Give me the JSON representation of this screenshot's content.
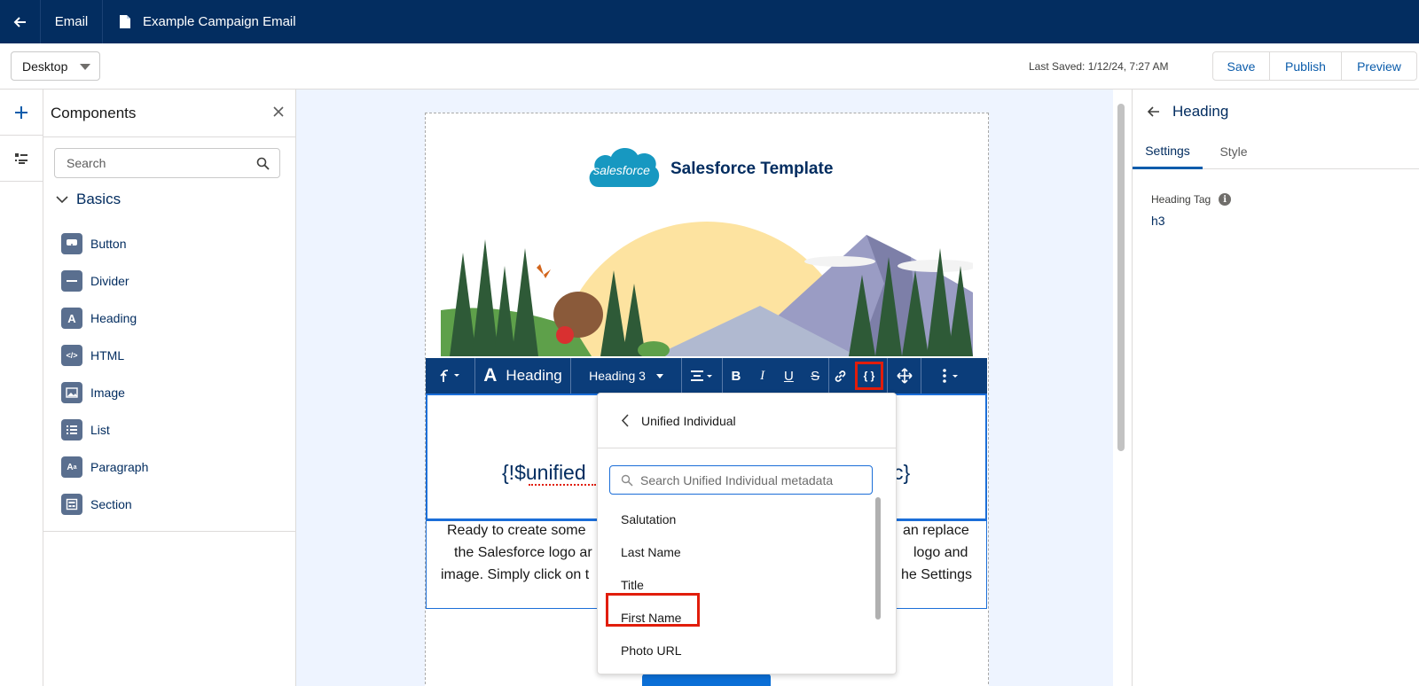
{
  "topbar": {
    "email_label": "Email",
    "document_title": "Example Campaign Email"
  },
  "toolbar": {
    "device": "Desktop",
    "last_saved": "Last Saved: 1/12/24, 7:27 AM",
    "save_label": "Save",
    "publish_label": "Publish",
    "preview_label": "Preview"
  },
  "components": {
    "title": "Components",
    "search_placeholder": "Search",
    "section_title": "Basics",
    "items": [
      {
        "label": "Button",
        "icon": "button-icon"
      },
      {
        "label": "Divider",
        "icon": "divider-icon"
      },
      {
        "label": "Heading",
        "icon": "heading-icon"
      },
      {
        "label": "HTML",
        "icon": "html-icon"
      },
      {
        "label": "Image",
        "icon": "image-icon"
      },
      {
        "label": "List",
        "icon": "list-icon"
      },
      {
        "label": "Paragraph",
        "icon": "paragraph-icon"
      },
      {
        "label": "Section",
        "icon": "section-icon"
      }
    ]
  },
  "email": {
    "template_title": "Salesforce Template",
    "logo_text": "salesforce",
    "heading_left": "{!$unified",
    "heading_right": "c}",
    "para_lines": [
      {
        "left": "Ready to create some",
        "right": "an replace"
      },
      {
        "left": "the Salesforce logo ar",
        "right": "logo and"
      },
      {
        "left": "image. Simply click on t",
        "right": "he Settings"
      }
    ]
  },
  "rich_toolbar": {
    "block_type": "Heading",
    "heading_level": "Heading 3"
  },
  "merge_dropdown": {
    "back_label": "Unified Individual",
    "search_placeholder": "Search Unified Individual metadata",
    "items": [
      "Salutation",
      "Last Name",
      "Title",
      "First Name",
      "Photo URL"
    ],
    "highlighted_item": "First Name"
  },
  "properties": {
    "title": "Heading",
    "tabs": [
      "Settings",
      "Style"
    ],
    "active_tab": "Settings",
    "field_label": "Heading Tag",
    "field_value": "h3"
  },
  "colors": {
    "nav_bg": "#032d60",
    "toolbar_bg": "#0b3d7a",
    "accent": "#0b5cab",
    "highlight": "#e11d0b",
    "canvas_bg": "#eef4ff"
  }
}
